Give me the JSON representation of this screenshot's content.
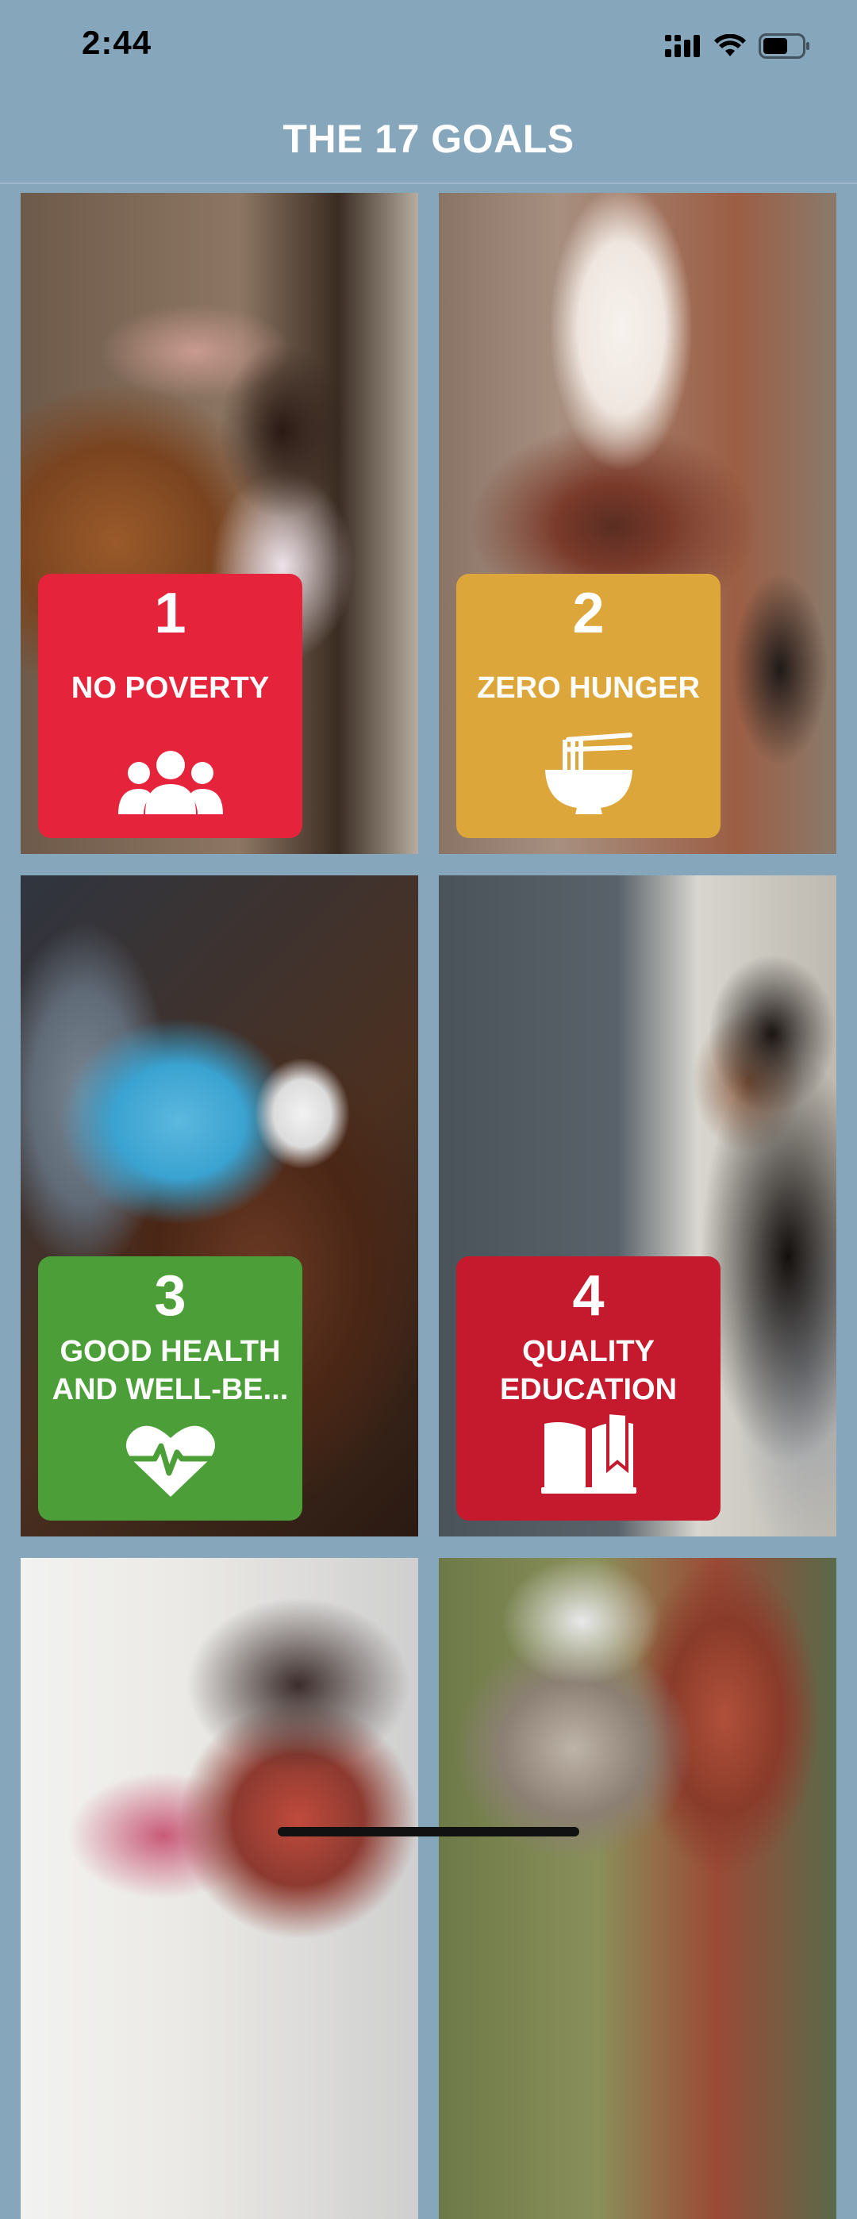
{
  "status_bar": {
    "time": "2:44",
    "icons": [
      "cellular-signal-icon",
      "wifi-icon",
      "battery-icon"
    ]
  },
  "header": {
    "title": "THE 17 GOALS"
  },
  "goals": [
    {
      "number": "1",
      "title": "NO POVERTY",
      "color": "#e5243b",
      "icon": "people-icon"
    },
    {
      "number": "2",
      "title": "ZERO HUNGER",
      "color": "#dda63a",
      "icon": "bowl-icon"
    },
    {
      "number": "3",
      "title": "GOOD HEALTH AND WELL-BE...",
      "color": "#4c9f38",
      "icon": "heart-pulse-icon"
    },
    {
      "number": "4",
      "title": "QUALITY EDUCATION",
      "color": "#c5192d",
      "icon": "book-icon"
    }
  ],
  "colors": {
    "background": "#86a6bb",
    "header_text": "#ffffff"
  }
}
